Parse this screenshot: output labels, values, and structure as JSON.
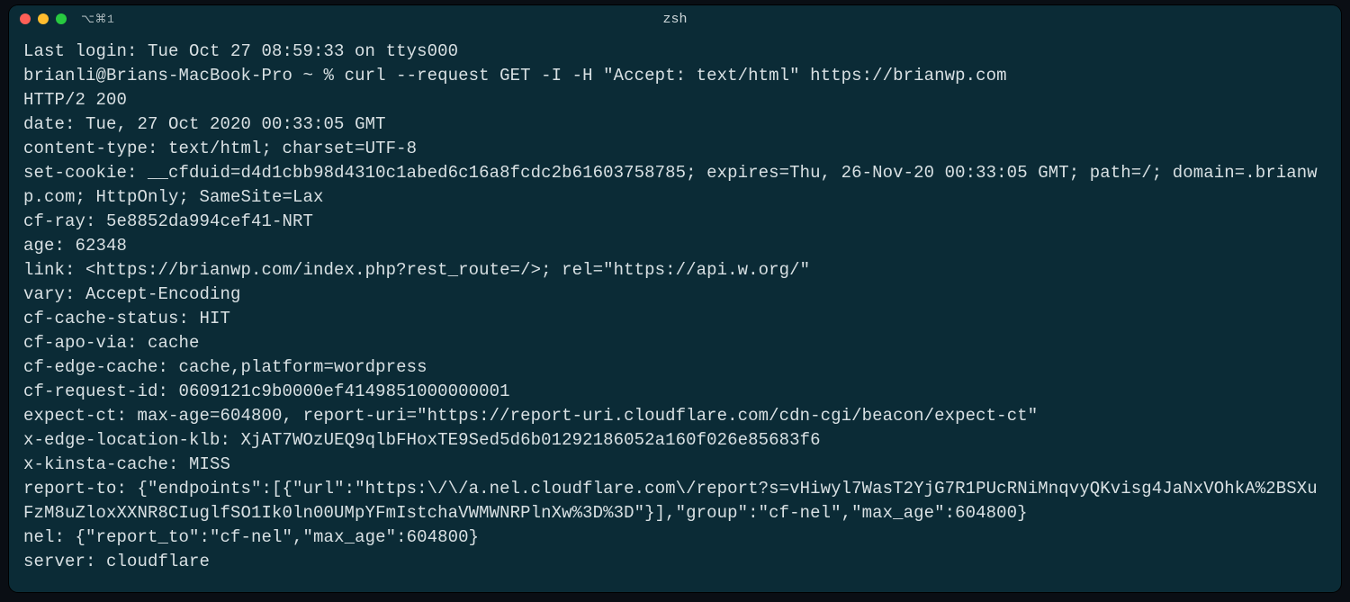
{
  "window": {
    "tab_label": "⌥⌘1",
    "title": "zsh"
  },
  "terminal": {
    "last_login": "Last login: Tue Oct 27 08:59:33 on ttys000",
    "prompt": "brianli@Brians-MacBook-Pro ~ % ",
    "command": "curl --request GET -I -H \"Accept: text/html\" https://brianwp.com",
    "status_line": "HTTP/2 200",
    "headers": {
      "date": {
        "k": "date:",
        "v": " Tue, 27 Oct 2020 00:33:05 GMT"
      },
      "content_type": {
        "k": "content-type:",
        "v": " text/html; charset=UTF-8"
      },
      "set_cookie": {
        "k": "set-cookie:",
        "v": " __cfduid=d4d1cbb98d4310c1abed6c16a8fcdc2b61603758785; expires=Thu, 26-Nov-20 00:33:05 GMT; path=/; domain=.brianwp.com; HttpOnly; SameSite=Lax"
      },
      "cf_ray": {
        "k": "cf-ray:",
        "v": " 5e8852da994cef41-NRT"
      },
      "age": {
        "k": "age:",
        "v": " 62348"
      },
      "link": {
        "k": "link:",
        "v": " <https://brianwp.com/index.php?rest_route=/>; rel=\"https://api.w.org/\""
      },
      "vary": {
        "k": "vary:",
        "v": " Accept-Encoding"
      },
      "cf_cache_status": {
        "k": "cf-cache-status:",
        "v": " HIT"
      },
      "cf_apo_via": {
        "k": "cf-apo-via:",
        "v": " cache"
      },
      "cf_edge_cache": {
        "k": "cf-edge-cache:",
        "v": " cache,platform=wordpress"
      },
      "cf_request_id": {
        "k": "cf-request-id:",
        "v": " 0609121c9b0000ef4149851000000001"
      },
      "expect_ct": {
        "k": "expect-ct:",
        "v": " max-age=604800, report-uri=\"https://report-uri.cloudflare.com/cdn-cgi/beacon/expect-ct\""
      },
      "x_edge_location_klb": {
        "k": "x-edge-location-klb:",
        "v": " XjAT7WOzUEQ9qlbFHoxTE9Sed5d6b01292186052a160f026e85683f6"
      },
      "x_kinsta_cache": {
        "k": "x-kinsta-cache:",
        "v": " MISS"
      },
      "report_to": {
        "k": "report-to:",
        "v": " {\"endpoints\":[{\"url\":\"https:\\/\\/a.nel.cloudflare.com\\/report?s=vHiwyl7WasT2YjG7R1PUcRNiMnqvyQKvisg4JaNxVOhkA%2BSXuFzM8uZloxXXNR8CIuglfSO1Ik0ln00UMpYFmIstchaVWMWNRPlnXw%3D%3D\"}],\"group\":\"cf-nel\",\"max_age\":604800}"
      },
      "nel": {
        "k": "nel:",
        "v": " {\"report_to\":\"cf-nel\",\"max_age\":604800}"
      },
      "server": {
        "k": "server:",
        "v": " cloudflare"
      }
    }
  }
}
